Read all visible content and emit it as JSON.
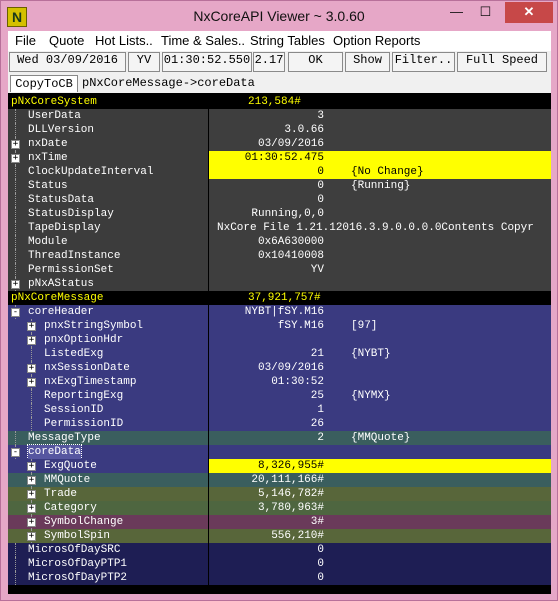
{
  "window": {
    "title": "NxCoreAPI Viewer ~ 3.0.60",
    "icon_letter": "N",
    "min": "—",
    "max": "☐",
    "close": "✕"
  },
  "menu": [
    "File",
    "Quote",
    "Hot Lists..",
    "Time & Sales..",
    "String Tables",
    "Option Reports"
  ],
  "toolbar": {
    "date": "Wed 03/09/2016",
    "yv": "YV",
    "time": "01:30:52.550",
    "speed_factor": "2.17",
    "ok": "OK",
    "show": "Show",
    "filter": "Filter..",
    "full_speed": "Full Speed"
  },
  "copy_tab": "CopyToCB",
  "path": "pNxCoreMessage->coreData",
  "colors": {
    "yellow": "#ffff00",
    "grey_left": "#3c3c3c",
    "grey_right": "#3e3e3e",
    "navy": "#3a3a80",
    "teal": "#3a5e5e",
    "olive": "#58663a",
    "maroon": "#6a3a5a",
    "dark_navy": "#1e1e54",
    "mono_text": "#ffffff"
  },
  "tree": [
    {
      "label": "pNxCoreSystem",
      "value": "213,584#",
      "ann": "",
      "level": 0,
      "exp": "",
      "style": "head"
    },
    {
      "label": "UserData",
      "value": "3",
      "ann": "",
      "level": 1,
      "exp": "",
      "style": "grey"
    },
    {
      "label": "DLLVersion",
      "value": "3.0.66",
      "ann": "",
      "level": 1,
      "exp": "",
      "style": "grey"
    },
    {
      "label": "nxDate",
      "value": "03/09/2016",
      "ann": "",
      "level": 1,
      "exp": "+",
      "style": "grey"
    },
    {
      "label": "nxTime",
      "value": "01:30:52.475",
      "ann": "",
      "level": 1,
      "exp": "+",
      "style": "grey_y"
    },
    {
      "label": "ClockUpdateInterval",
      "value": "0",
      "ann": "{No Change}",
      "level": 1,
      "exp": "",
      "style": "grey_y"
    },
    {
      "label": "Status",
      "value": "0",
      "ann": "{Running}",
      "level": 1,
      "exp": "",
      "style": "grey"
    },
    {
      "label": "StatusData",
      "value": "0",
      "ann": "",
      "level": 1,
      "exp": "",
      "style": "grey"
    },
    {
      "label": "StatusDisplay",
      "value": "Running,0,0",
      "ann": "",
      "level": 1,
      "exp": "",
      "style": "grey"
    },
    {
      "label": "TapeDisplay",
      "value": "NxCore File 1.21.12016.3.9.0.0.0.0Contents Copyr",
      "ann": "",
      "level": 1,
      "exp": "",
      "style": "grey_long"
    },
    {
      "label": "Module",
      "value": "0x6A630000",
      "ann": "",
      "level": 1,
      "exp": "",
      "style": "grey"
    },
    {
      "label": "ThreadInstance",
      "value": "0x10410008",
      "ann": "",
      "level": 1,
      "exp": "",
      "style": "grey"
    },
    {
      "label": "PermissionSet",
      "value": "YV",
      "ann": "",
      "level": 1,
      "exp": "",
      "style": "grey"
    },
    {
      "label": "pNxAStatus",
      "value": "",
      "ann": "",
      "level": 1,
      "exp": "+",
      "style": "grey"
    },
    {
      "label": "pNxCoreMessage",
      "value": "37,921,757#",
      "ann": "",
      "level": 0,
      "exp": "",
      "style": "head"
    },
    {
      "label": "coreHeader",
      "value": "NYBT|fSY.M16",
      "ann": "",
      "level": 1,
      "exp": "-",
      "style": "navy"
    },
    {
      "label": "pnxStringSymbol",
      "value": "fSY.M16",
      "ann": "[97]",
      "level": 2,
      "exp": "+",
      "style": "navy"
    },
    {
      "label": "pnxOptionHdr",
      "value": "",
      "ann": "",
      "level": 2,
      "exp": "+",
      "style": "navy"
    },
    {
      "label": "ListedExg",
      "value": "21",
      "ann": "{NYBT}",
      "level": 2,
      "exp": "",
      "style": "navy"
    },
    {
      "label": "nxSessionDate",
      "value": "03/09/2016",
      "ann": "",
      "level": 2,
      "exp": "+",
      "style": "navy"
    },
    {
      "label": "nxExgTimestamp",
      "value": "01:30:52",
      "ann": "",
      "level": 2,
      "exp": "+",
      "style": "navy"
    },
    {
      "label": "ReportingExg",
      "value": "25",
      "ann": "{NYMX}",
      "level": 2,
      "exp": "",
      "style": "navy"
    },
    {
      "label": "SessionID",
      "value": "1",
      "ann": "",
      "level": 2,
      "exp": "",
      "style": "navy"
    },
    {
      "label": "PermissionID",
      "value": "26",
      "ann": "",
      "level": 2,
      "exp": "",
      "style": "navy"
    },
    {
      "label": "MessageType",
      "value": "2",
      "ann": "{MMQuote}",
      "level": 1,
      "exp": "",
      "style": "teal"
    },
    {
      "label": "coreData",
      "value": "",
      "ann": "",
      "level": 1,
      "exp": "-",
      "style": "navy_sel"
    },
    {
      "label": "ExgQuote",
      "value": "8,326,955#",
      "ann": "",
      "level": 2,
      "exp": "+",
      "style": "navy_y"
    },
    {
      "label": "MMQuote",
      "value": "20,111,166#",
      "ann": "",
      "level": 2,
      "exp": "+",
      "style": "teal"
    },
    {
      "label": "Trade",
      "value": "5,146,782#",
      "ann": "",
      "level": 2,
      "exp": "+",
      "style": "olive"
    },
    {
      "label": "Category",
      "value": "3,780,963#",
      "ann": "",
      "level": 2,
      "exp": "+",
      "style": "olive2"
    },
    {
      "label": "SymbolChange",
      "value": "3#",
      "ann": "",
      "level": 2,
      "exp": "+",
      "style": "maroon"
    },
    {
      "label": "SymbolSpin",
      "value": "556,210#",
      "ann": "",
      "level": 2,
      "exp": "+",
      "style": "olive"
    },
    {
      "label": "MicrosOfDaySRC",
      "value": "0",
      "ann": "",
      "level": 1,
      "exp": "",
      "style": "dark"
    },
    {
      "label": "MicrosOfDayPTP1",
      "value": "0",
      "ann": "",
      "level": 1,
      "exp": "",
      "style": "dark"
    },
    {
      "label": "MicrosOfDayPTP2",
      "value": "0",
      "ann": "",
      "level": 1,
      "exp": "",
      "style": "dark"
    }
  ]
}
